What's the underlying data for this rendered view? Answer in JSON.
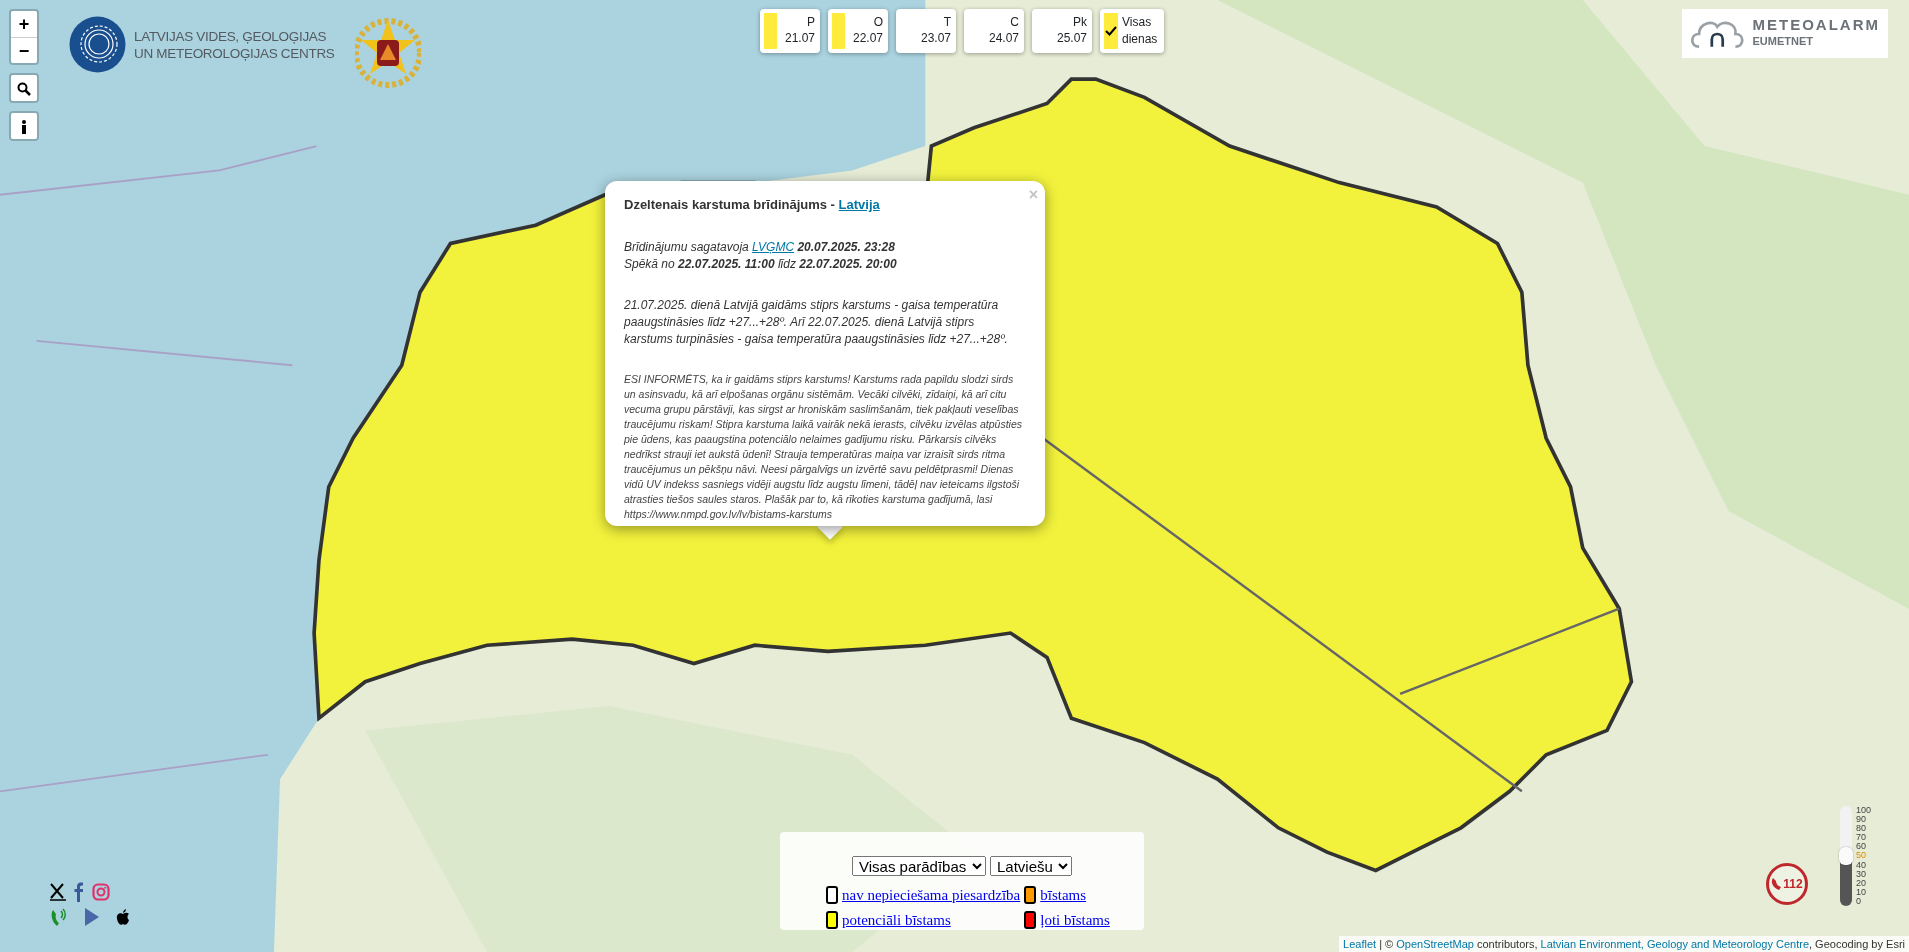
{
  "zoom_controls": [
    "+",
    "−"
  ],
  "agency": {
    "name_lines": [
      "LATVIJAS VIDES, ĢEOLOĢIJAS",
      "UN METEOROLOĢIJAS CENTRS"
    ]
  },
  "days": [
    {
      "day": "P",
      "date": "21.07",
      "color": "#ffeb3b"
    },
    {
      "day": "O",
      "date": "22.07",
      "color": "#ffeb3b"
    },
    {
      "day": "T",
      "date": "23.07"
    },
    {
      "day": "C",
      "date": "24.07"
    },
    {
      "day": "Pk",
      "date": "25.07"
    }
  ],
  "all_days": {
    "label_lines": [
      "Visas",
      "dienas"
    ],
    "checked": true
  },
  "meteoalarm": {
    "title": "METEOALARM",
    "subtitle": "EUMETNET"
  },
  "popup": {
    "close": "×",
    "title": [
      {
        "kind": "text",
        "text": "Dzeltenais karstuma brīdinājums - "
      },
      {
        "kind": "link",
        "text": "Latvija"
      }
    ],
    "issued": [
      {
        "kind": "text",
        "text": "Brīdinājumu sagatavoja "
      },
      {
        "kind": "link",
        "text": "LVĢMC"
      },
      {
        "kind": "bold",
        "text": " 20.07.2025. 23:28"
      }
    ],
    "valid": [
      {
        "kind": "text",
        "text": "Spēkā no "
      },
      {
        "kind": "bold",
        "text": "22.07.2025. 11:00"
      },
      {
        "kind": "text",
        "text": " līdz "
      },
      {
        "kind": "bold",
        "text": "22.07.2025. 20:00"
      }
    ],
    "description": "21.07.2025. dienā Latvijā gaidāms stiprs karstums - gaisa temperatūra paaugstināsies līdz +27...+28º. Arī 22.07.2025. dienā Latvijā stiprs karstums turpināsies - gaisa temperatūra paaugstināsies līdz +27...+28º.",
    "advice": "ESI INFORMĒTS, ka ir gaidāms stiprs karstums! Karstums rada papildu slodzi sirds un asinsvadu, kā arī elpošanas orgānu sistēmām. Vecāki cilvēki, zīdaiņi, kā arī citu vecuma grupu pārstāvji, kas sirgst ar hroniskām saslimšanām, tiek pakļauti veselības traucējumu riskam! Stipra karstuma laikā vairāk nekā ierasts, cilvēku izvēlas atpūsties pie ūdens, kas paaugstina potenciālo nelaimes gadījumu risku. Pārkarsis cilvēks nedrīkst strauji iet aukstā ūdenī! Strauja temperatūras maiņa var izraisīt sirds ritma traucējumus un pēkšņu nāvi. Neesi pārgalvīgs un izvērtē savu peldētprasmi! Dienas vidū UV indekss sasniegs vidēji augstu līdz augstu līmeni, tādēļ nav ieteicams ilgstoši atrasties tiešos saules staros. Plašāk par to, kā rīkoties karstuma gadījumā, lasi https://www.nmpd.gov.lv/lv/bistams-karstums"
  },
  "legend": {
    "hazard_select": "Visas parādības",
    "language_select": "Latviešu",
    "items": [
      {
        "label": "nav nepieciešama piesardzība",
        "color": "#ffffff"
      },
      {
        "label": "bīstams",
        "color": "#ff9900"
      },
      {
        "label": "potenciāli bīstams",
        "color": "#ffff00"
      },
      {
        "label": "ļoti bīstams",
        "color": "#ff0000"
      }
    ]
  },
  "emergency": {
    "number": "112"
  },
  "opacity": {
    "level": 0.5,
    "ticks": [
      "100",
      "90",
      "80",
      "70",
      "60",
      "50",
      "40",
      "30",
      "20",
      "10",
      "0"
    ]
  },
  "attribution": [
    {
      "kind": "link",
      "text": "Leaflet"
    },
    {
      "kind": "text",
      "text": " | © "
    },
    {
      "kind": "link",
      "text": "OpenStreetMap"
    },
    {
      "kind": "text",
      "text": " contributors, "
    },
    {
      "kind": "link",
      "text": "Latvian Environment, Geology and Meteorology Centre"
    },
    {
      "kind": "text",
      "text": ", Geocoding by Esri"
    }
  ]
}
